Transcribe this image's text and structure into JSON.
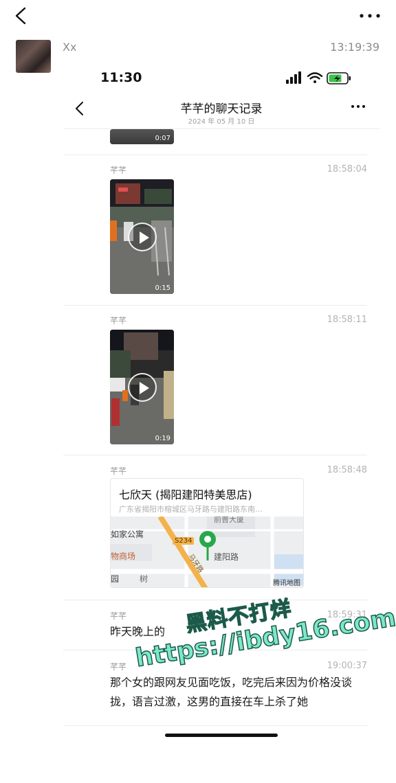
{
  "outer": {
    "sender_name": "Xx",
    "sender_time": "13:19:39"
  },
  "status": {
    "time": "11:30"
  },
  "chat": {
    "title": "芊芊的聊天记录",
    "date": "2024 年 05 月 10 日"
  },
  "messages": [
    {
      "type": "video",
      "duration": "0:07"
    },
    {
      "type": "video",
      "name": "芊芊",
      "time": "18:58:04",
      "duration": "0:15"
    },
    {
      "type": "video",
      "name": "芊芊",
      "time": "18:58:11",
      "duration": "0:19"
    },
    {
      "type": "location",
      "name": "芊芊",
      "time": "18:58:48",
      "title": "七欣天 (揭阳建阳特美思店)",
      "address": "广东省揭阳市榕城区马牙路与建阳路东南…",
      "map_labels": {
        "tower": "前普大厦",
        "apartment": "如家公寓",
        "shop": "物商场",
        "road_tag": "S234",
        "road_main": "建阳路",
        "road_diag": "马牙路",
        "park": "园",
        "tree": "树",
        "provider": "腾讯地图"
      }
    },
    {
      "type": "text",
      "name": "芊芊",
      "time": "18:59:31",
      "text": "昨天晚上的"
    },
    {
      "type": "text",
      "name": "芊芊",
      "time": "19:00:37",
      "text": "那个女的跟网友见面吃饭，吃完后来因为价格没谈拢，语言过激，这男的直接在车上杀了她"
    }
  ],
  "watermark": {
    "line1": "黑料不打烊",
    "line2": "https://ibdy16.com"
  },
  "colors": {
    "accent_green": "#2faa4a",
    "watermark": "#7de8c9",
    "map_pin": "#27a84a"
  }
}
